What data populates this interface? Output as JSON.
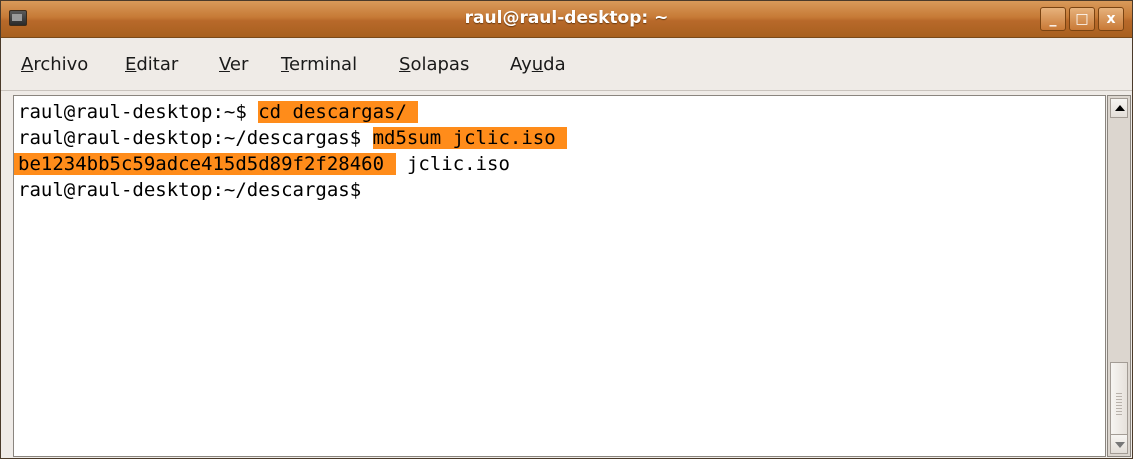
{
  "window": {
    "title": "raul@raul-desktop: ~",
    "buttons": {
      "minimize": "_",
      "maximize": "□",
      "close": "x"
    }
  },
  "menu": [
    {
      "accel": "A",
      "rest": "rchivo"
    },
    {
      "accel": "E",
      "rest": "ditar"
    },
    {
      "accel": "V",
      "rest": "er"
    },
    {
      "accel": "T",
      "rest": "erminal"
    },
    {
      "accel": "S",
      "rest": "olapas"
    },
    {
      "pre": "Ay",
      "accel": "u",
      "rest": "da"
    }
  ],
  "terminal": {
    "lines": [
      {
        "prompt": "raul@raul-desktop:~$ ",
        "command": "cd descargas/ "
      },
      {
        "prompt": "raul@raul-desktop:~/descargas$ ",
        "command": "md5sum jclic.iso "
      },
      {
        "hash": "be1234bb5c59adce415d5d89f2f28460 ",
        "rest": " jclic.iso"
      },
      {
        "prompt": "raul@raul-desktop:~/descargas$"
      }
    ],
    "highlight_color": "#ff8c1a"
  }
}
